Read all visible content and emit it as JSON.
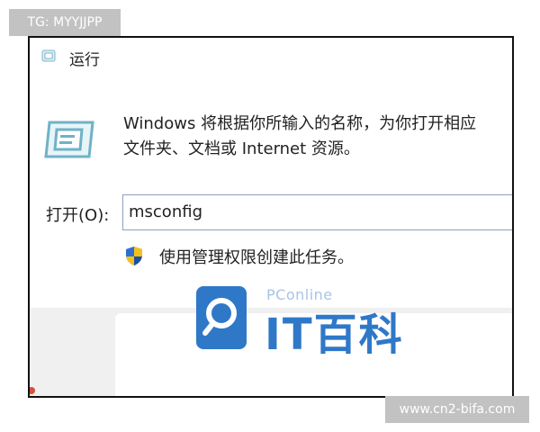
{
  "watermark_top": "TG: MYYJJPP",
  "watermark_bottom": "www.cn2-bifa.com",
  "dialog": {
    "title": "运行",
    "description_line1": "Windows 将根据你所输入的名称，为你打开相应",
    "description_line2": "文件夹、文档或 Internet 资源。",
    "open_label": "打开(O):",
    "open_value": "msconfig",
    "admin_text": "使用管理权限创建此任务。"
  },
  "logo": {
    "brand": "PConline",
    "name": "IT百科"
  },
  "colors": {
    "accent": "#2f78c8",
    "logo_light": "#aac3e6",
    "watermark_bg": "#c2c2c2"
  }
}
